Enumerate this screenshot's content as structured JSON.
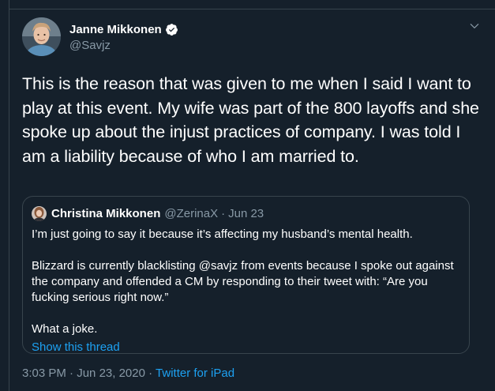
{
  "tweet": {
    "author": {
      "display_name": "Janne Mikkonen",
      "handle": "@Savjz",
      "verified": true
    },
    "text": "This is the reason that was given to me when I said I want to play at this event. My wife was part of the 800 layoffs and she spoke up about the injust practices of company. I was told I am a liability because of who I am married to.",
    "quoted": {
      "display_name": "Christina Mikkonen",
      "handle": "@ZerinaX",
      "separator": "·",
      "date": "Jun 23",
      "paragraphs": [
        "I’m just going to say it because it’s affecting my husband’s mental health.",
        "Blizzard is currently blacklisting @savjz from events because I spoke out against the company and offended a CM by responding to their tweet with: “Are you fucking serious right now.”",
        "What a joke."
      ],
      "show_thread": "Show this thread"
    },
    "footer": {
      "time": "3:03 PM",
      "separator1": "·",
      "date": "Jun 23, 2020",
      "separator2": "·",
      "source": "Twitter for iPad"
    }
  },
  "colors": {
    "background": "#15202b",
    "border": "#38444d",
    "secondary_text": "#8899a6",
    "link": "#1da1f2"
  },
  "icons": {
    "verified": "verified-badge-icon",
    "caret": "chevron-down-icon"
  }
}
